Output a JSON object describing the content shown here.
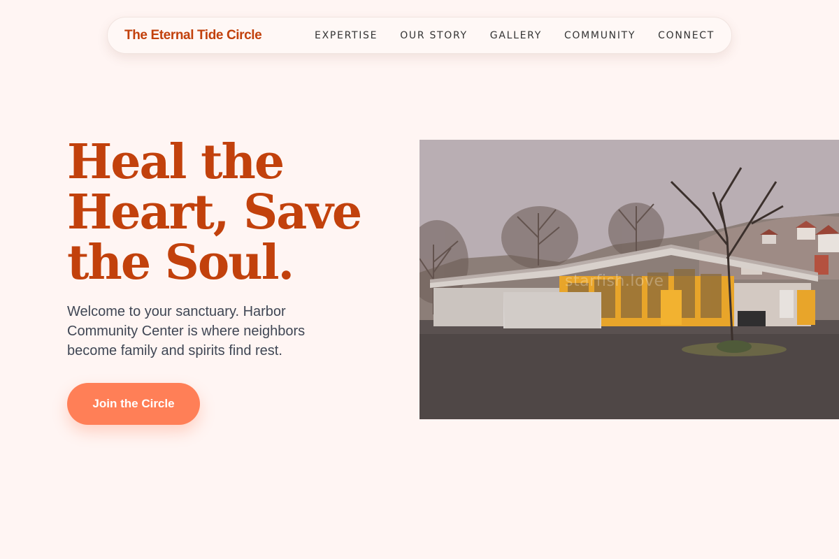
{
  "nav": {
    "brand": "The Eternal Tide Circle",
    "links": [
      {
        "label": "EXPERTISE"
      },
      {
        "label": "OUR STORY"
      },
      {
        "label": "GALLERY"
      },
      {
        "label": "COMMUNITY"
      },
      {
        "label": "CONNECT"
      }
    ]
  },
  "hero": {
    "title": "Heal the Heart, Save the Soul.",
    "subtitle": "Welcome to your sanctuary. Harbor Community Center is where neighbors become family and spirits find rest.",
    "cta_label": "Join the Circle",
    "image": {
      "watermark": "starfish.love"
    }
  },
  "colors": {
    "background": "#fff5f3",
    "accent": "#c2410c",
    "button": "#ff7f57",
    "body_text": "#3f4654"
  }
}
